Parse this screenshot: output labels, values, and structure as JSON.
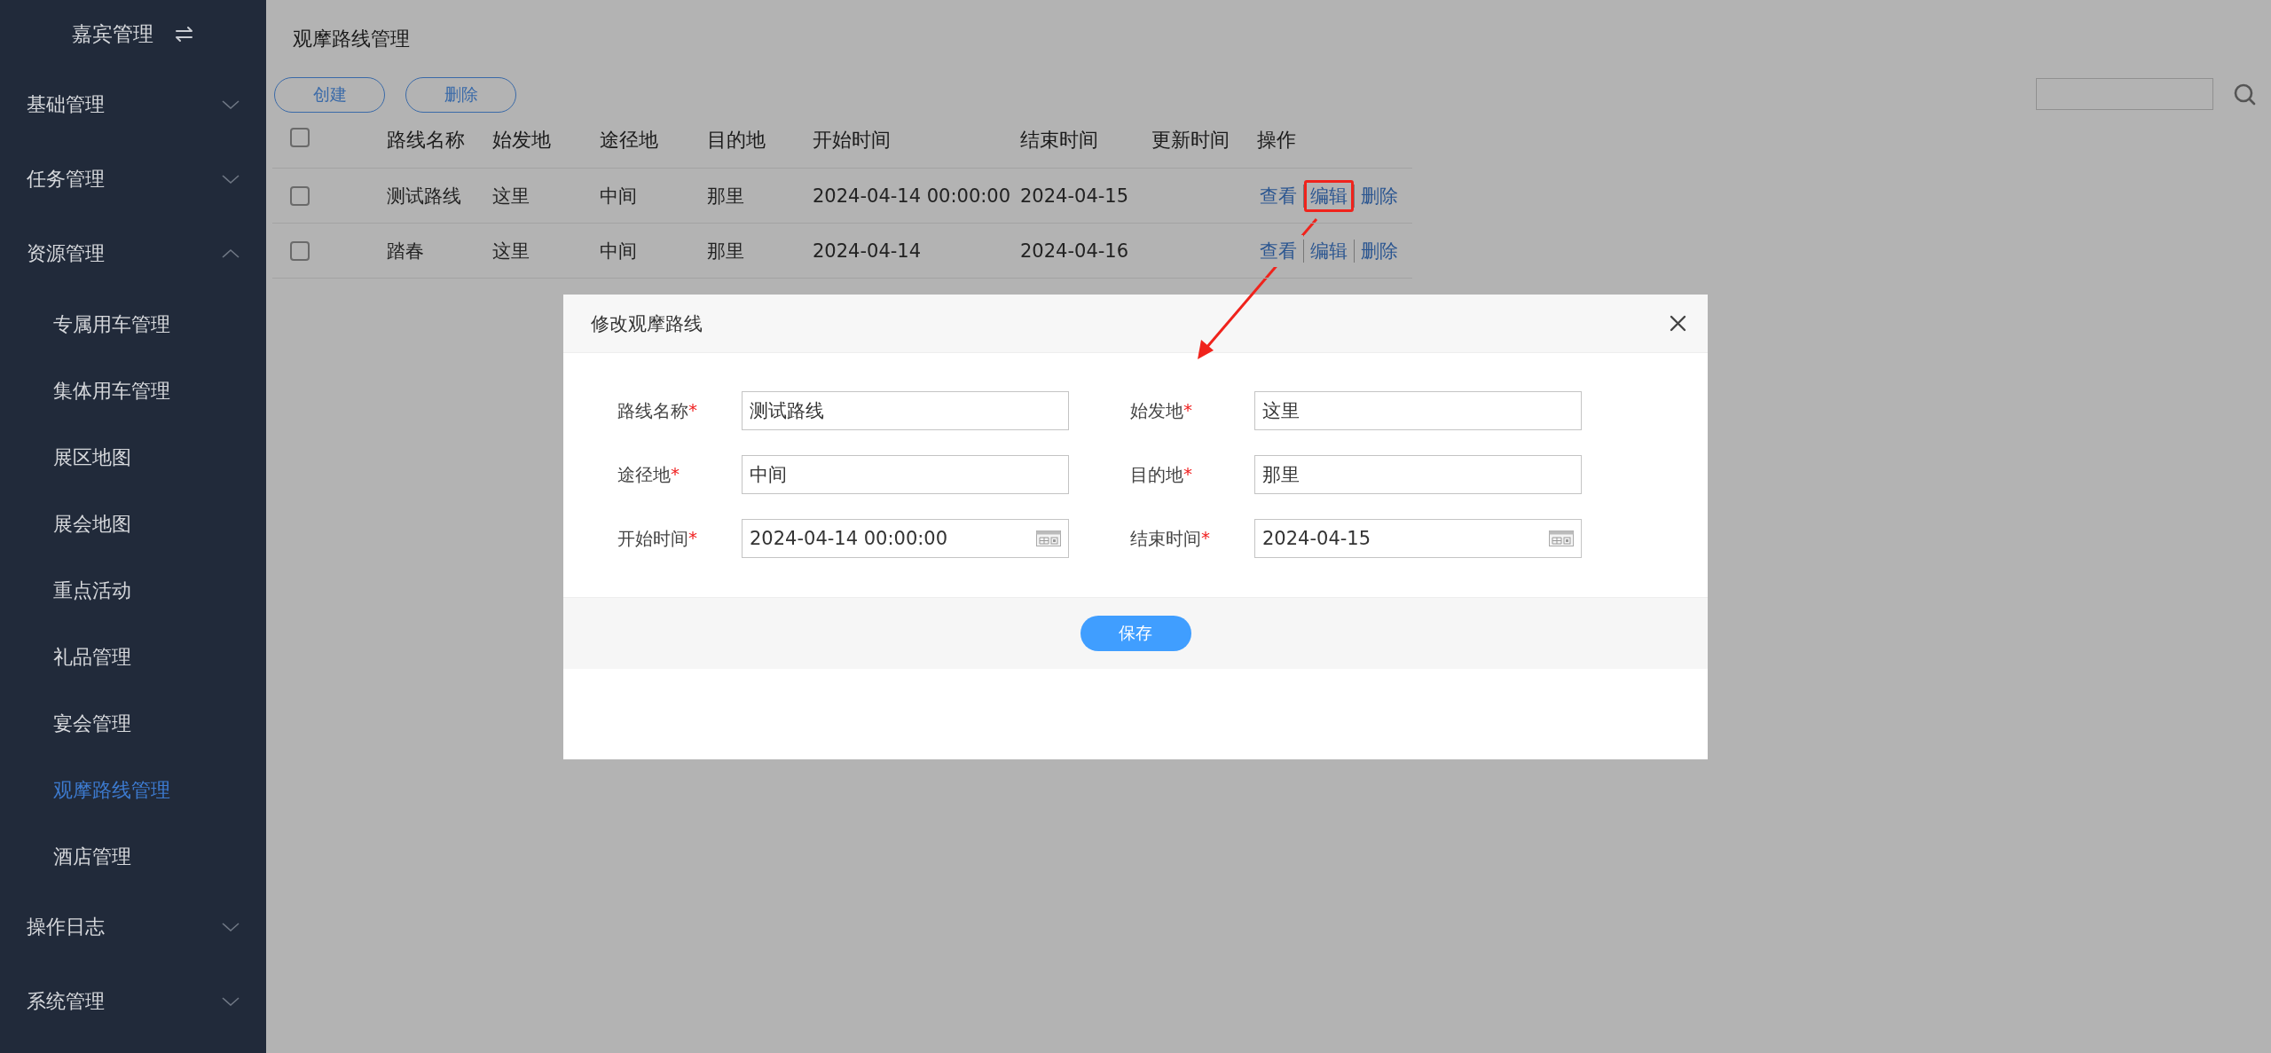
{
  "sidebar": {
    "title": "嘉宾管理",
    "menu": [
      {
        "label": "基础管理",
        "expanded": false
      },
      {
        "label": "任务管理",
        "expanded": false
      },
      {
        "label": "资源管理",
        "expanded": true,
        "children": [
          {
            "label": "专属用车管理",
            "selected": false
          },
          {
            "label": "集体用车管理",
            "selected": false
          },
          {
            "label": "展区地图",
            "selected": false
          },
          {
            "label": "展会地图",
            "selected": false
          },
          {
            "label": "重点活动",
            "selected": false
          },
          {
            "label": "礼品管理",
            "selected": false
          },
          {
            "label": "宴会管理",
            "selected": false
          },
          {
            "label": "观摩路线管理",
            "selected": true
          },
          {
            "label": "酒店管理",
            "selected": false
          }
        ]
      },
      {
        "label": "操作日志",
        "expanded": false
      },
      {
        "label": "系统管理",
        "expanded": false
      }
    ]
  },
  "page_title": "观摩路线管理",
  "toolbar": {
    "buttons": [
      "创建",
      "删除"
    ]
  },
  "table": {
    "select_all_checked": false,
    "columns": [
      "路线名称",
      "始发地",
      "途径地",
      "目的地",
      "开始时间",
      "结束时间",
      "更新时间",
      "操作"
    ],
    "rows": [
      {
        "checked": false,
        "cells": [
          "测试路线",
          "这里",
          "中间",
          "那里",
          "2024-04-14 00:00:00",
          "2024-04-15",
          ""
        ],
        "actions": [
          {
            "label": "查看",
            "highlighted": false
          },
          {
            "label": "编辑",
            "highlighted": true
          },
          {
            "label": "删除",
            "highlighted": false
          }
        ]
      },
      {
        "checked": false,
        "cells": [
          "踏春",
          "这里",
          "中间",
          "那里",
          "2024-04-14",
          "2024-04-16",
          ""
        ],
        "actions": [
          {
            "label": "查看",
            "highlighted": false
          },
          {
            "label": "编辑",
            "highlighted": false
          },
          {
            "label": "删除",
            "highlighted": false
          }
        ]
      }
    ]
  },
  "modal": {
    "title": "修改观摩路线",
    "fields": [
      {
        "label": "路线名称",
        "required_mark": "*",
        "value": "测试路线",
        "kind": "text"
      },
      {
        "label": "始发地",
        "required_mark": "*",
        "value": "这里",
        "kind": "text"
      },
      {
        "label": "途径地",
        "required_mark": "*",
        "value": "中间",
        "kind": "text"
      },
      {
        "label": "目的地",
        "required_mark": "*",
        "value": "那里",
        "kind": "text"
      },
      {
        "label": "开始时间",
        "required_mark": "*",
        "value": "2024-04-14 00:00:00",
        "kind": "date"
      },
      {
        "label": "结束时间",
        "required_mark": "*",
        "value": "2024-04-15",
        "kind": "date"
      }
    ],
    "save_button": "保存"
  }
}
